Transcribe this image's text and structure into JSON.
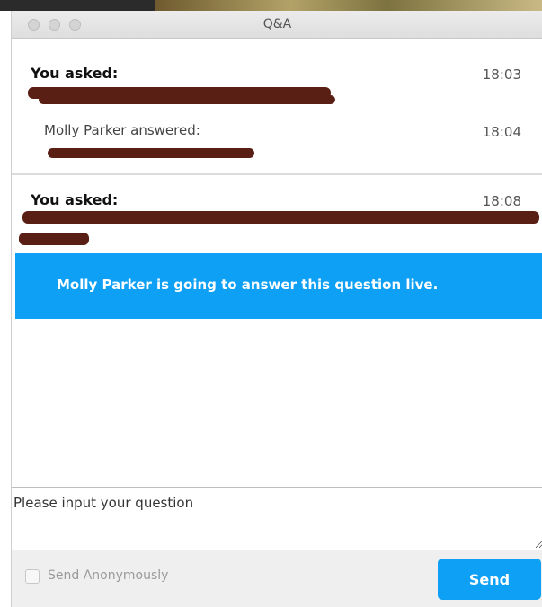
{
  "window": {
    "title": "Q&A"
  },
  "questions": [
    {
      "asker": "You asked:",
      "time": "18:03",
      "answer": {
        "answerer": "Molly Parker answered:",
        "time": "18:04"
      }
    },
    {
      "asker": "You asked:",
      "time": "18:08",
      "status": "Molly Parker is going to answer this question live."
    }
  ],
  "input": {
    "placeholder": "Please input your question",
    "value": ""
  },
  "footer": {
    "anonymous_label": "Send Anonymously",
    "anonymous_checked": false,
    "send_label": "Send"
  },
  "colors": {
    "accent": "#0ea0f5",
    "redaction": "#5a1f14"
  }
}
